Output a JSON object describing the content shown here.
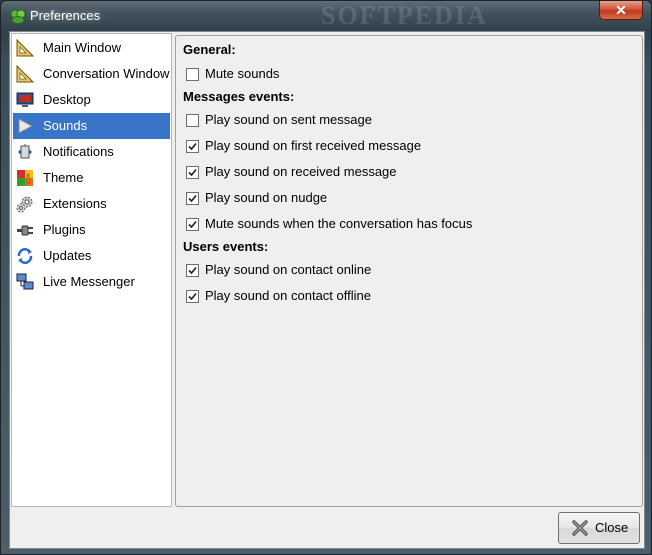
{
  "window": {
    "title": "Preferences",
    "watermark": "SOFTPEDIA",
    "close_glyph": "✕"
  },
  "sidebar": {
    "items": [
      {
        "label": "Main Window",
        "icon": "ruler-triangle-icon",
        "selected": false
      },
      {
        "label": "Conversation Window",
        "icon": "ruler-triangle-icon",
        "selected": false
      },
      {
        "label": "Desktop",
        "icon": "monitor-icon",
        "selected": false
      },
      {
        "label": "Sounds",
        "icon": "play-icon",
        "selected": true
      },
      {
        "label": "Notifications",
        "icon": "notification-icon",
        "selected": false
      },
      {
        "label": "Theme",
        "icon": "palette-icon",
        "selected": false
      },
      {
        "label": "Extensions",
        "icon": "gears-icon",
        "selected": false
      },
      {
        "label": "Plugins",
        "icon": "plug-icon",
        "selected": false
      },
      {
        "label": "Updates",
        "icon": "refresh-icon",
        "selected": false
      },
      {
        "label": "Live Messenger",
        "icon": "computers-icon",
        "selected": false
      }
    ]
  },
  "panel": {
    "general_heading": "General:",
    "mute_sounds": {
      "label": "Mute sounds",
      "checked": false
    },
    "messages_heading": "Messages events:",
    "messages": [
      {
        "label": "Play sound on sent message",
        "checked": false
      },
      {
        "label": "Play sound on first received message",
        "checked": true
      },
      {
        "label": "Play sound on received message",
        "checked": true
      },
      {
        "label": "Play sound on nudge",
        "checked": true
      },
      {
        "label": "Mute sounds when the conversation has focus",
        "checked": true
      }
    ],
    "users_heading": "Users events:",
    "users": [
      {
        "label": "Play sound on contact online",
        "checked": true
      },
      {
        "label": "Play sound on contact offline",
        "checked": true
      }
    ]
  },
  "footer": {
    "close_label": "Close"
  },
  "colors": {
    "selection": "#3875c8",
    "close_button": "#c8452a"
  }
}
